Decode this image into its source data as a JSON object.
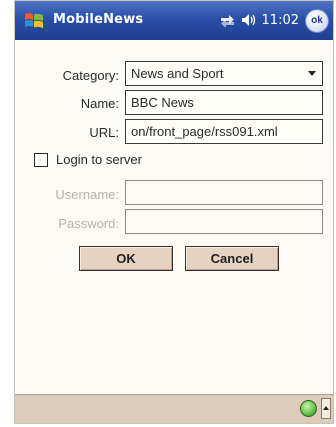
{
  "window": {
    "title": "MobileNews",
    "time": "11:02",
    "ok_label": "ok"
  },
  "form": {
    "category_label": "Category:",
    "category_value": "News and Sport",
    "name_label": "Name:",
    "name_value": "BBC News",
    "url_label": "URL:",
    "url_value": "on/front_page/rss091.xml",
    "login_label": "Login to server",
    "login_checked": false,
    "username_label": "Username:",
    "username_value": "",
    "password_label": "Password:",
    "password_value": ""
  },
  "buttons": {
    "ok": "OK",
    "cancel": "Cancel"
  },
  "icons": {
    "start": "windows-start-icon",
    "connectivity": "connectivity-icon",
    "volume": "speaker-icon",
    "sip": "input-panel-icon",
    "sip_toggle": "chevron-up-icon"
  },
  "colors": {
    "titlebar": "#2a4fa8",
    "button_face": "#e6d2c0",
    "bottombar": "#dccbb9",
    "disabled_text": "#b9b3a8"
  }
}
